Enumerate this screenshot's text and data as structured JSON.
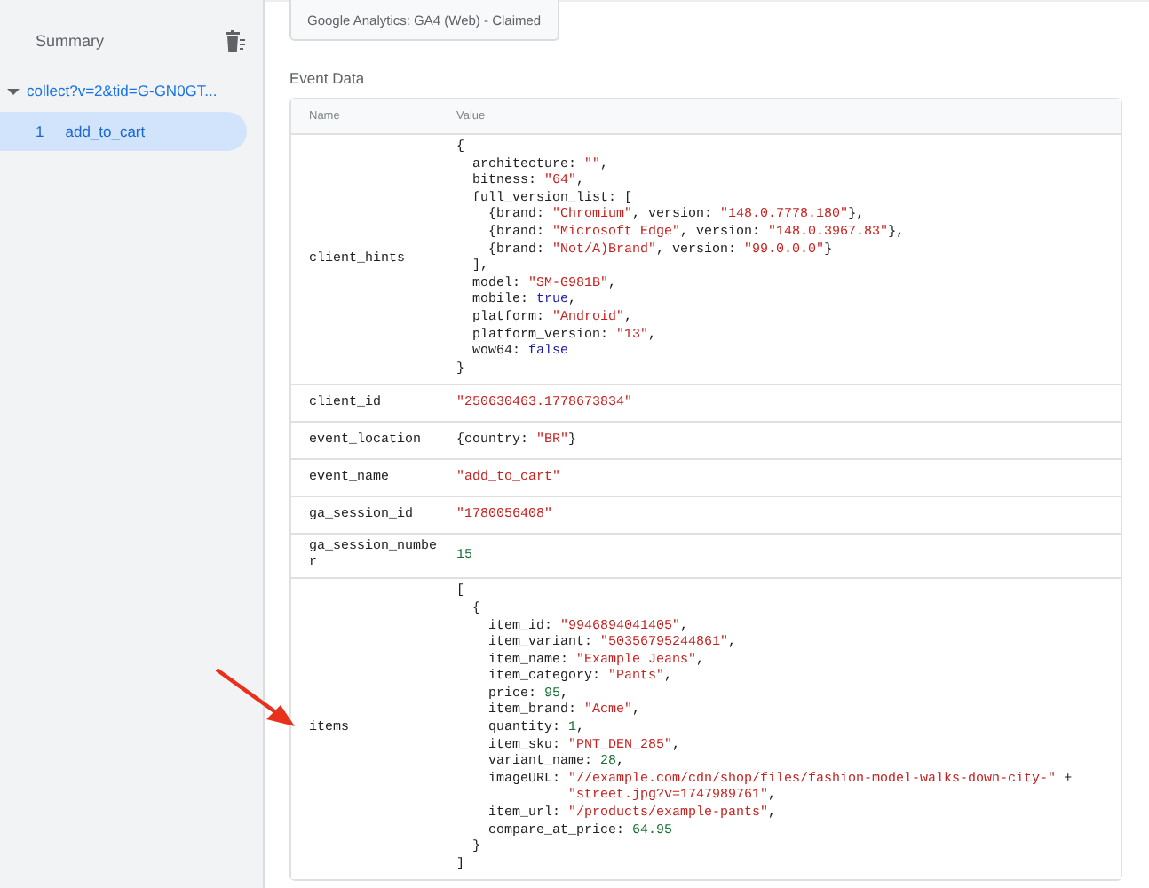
{
  "sidebar": {
    "title": "Summary",
    "request": {
      "label": "collect?v=2&tid=G-GN0GT...",
      "expanded": true
    },
    "events": [
      {
        "index": "1",
        "name": "add_to_cart",
        "selected": true
      }
    ]
  },
  "tag_card": {
    "label": "Google Analytics: GA4 (Web) - Claimed"
  },
  "section_title": "Event Data",
  "table": {
    "columns": [
      "Name",
      "Value"
    ],
    "rows": [
      {
        "name": "client_hints",
        "value": [
          [
            {
              "kind": "plain",
              "text": "{"
            }
          ],
          [
            {
              "kind": "plain",
              "text": "  architecture: "
            },
            {
              "kind": "string",
              "text": "\"\""
            },
            {
              "kind": "plain",
              "text": ","
            }
          ],
          [
            {
              "kind": "plain",
              "text": "  bitness: "
            },
            {
              "kind": "string",
              "text": "\"64\""
            },
            {
              "kind": "plain",
              "text": ","
            }
          ],
          [
            {
              "kind": "plain",
              "text": "  full_version_list: ["
            }
          ],
          [
            {
              "kind": "plain",
              "text": "    {brand: "
            },
            {
              "kind": "string",
              "text": "\"Chromium\""
            },
            {
              "kind": "plain",
              "text": ", version: "
            },
            {
              "kind": "string",
              "text": "\"148.0.7778.180\""
            },
            {
              "kind": "plain",
              "text": "},"
            }
          ],
          [
            {
              "kind": "plain",
              "text": "    {brand: "
            },
            {
              "kind": "string",
              "text": "\"Microsoft Edge\""
            },
            {
              "kind": "plain",
              "text": ", version: "
            },
            {
              "kind": "string",
              "text": "\"148.0.3967.83\""
            },
            {
              "kind": "plain",
              "text": "},"
            }
          ],
          [
            {
              "kind": "plain",
              "text": "    {brand: "
            },
            {
              "kind": "string",
              "text": "\"Not/A)Brand\""
            },
            {
              "kind": "plain",
              "text": ", version: "
            },
            {
              "kind": "string",
              "text": "\"99.0.0.0\""
            },
            {
              "kind": "plain",
              "text": "}"
            }
          ],
          [
            {
              "kind": "plain",
              "text": "  ],"
            }
          ],
          [
            {
              "kind": "plain",
              "text": "  model: "
            },
            {
              "kind": "string",
              "text": "\"SM-G981B\""
            },
            {
              "kind": "plain",
              "text": ","
            }
          ],
          [
            {
              "kind": "plain",
              "text": "  mobile: "
            },
            {
              "kind": "bool",
              "text": "true"
            },
            {
              "kind": "plain",
              "text": ","
            }
          ],
          [
            {
              "kind": "plain",
              "text": "  platform: "
            },
            {
              "kind": "string",
              "text": "\"Android\""
            },
            {
              "kind": "plain",
              "text": ","
            }
          ],
          [
            {
              "kind": "plain",
              "text": "  platform_version: "
            },
            {
              "kind": "string",
              "text": "\"13\""
            },
            {
              "kind": "plain",
              "text": ","
            }
          ],
          [
            {
              "kind": "plain",
              "text": "  wow64: "
            },
            {
              "kind": "bool",
              "text": "false"
            }
          ],
          [
            {
              "kind": "plain",
              "text": "}"
            }
          ]
        ]
      },
      {
        "name": "client_id",
        "value": [
          [
            {
              "kind": "string",
              "text": "\"250630463.1778673834\""
            }
          ]
        ]
      },
      {
        "name": "event_location",
        "value": [
          [
            {
              "kind": "plain",
              "text": "{country: "
            },
            {
              "kind": "string",
              "text": "\"BR\""
            },
            {
              "kind": "plain",
              "text": "}"
            }
          ]
        ]
      },
      {
        "name": "event_name",
        "value": [
          [
            {
              "kind": "string",
              "text": "\"add_to_cart\""
            }
          ]
        ]
      },
      {
        "name": "ga_session_id",
        "value": [
          [
            {
              "kind": "string",
              "text": "\"1780056408\""
            }
          ]
        ]
      },
      {
        "name": "ga_session_number",
        "value": [
          [
            {
              "kind": "number",
              "text": "15"
            }
          ]
        ]
      },
      {
        "name": "items",
        "value": [
          [
            {
              "kind": "plain",
              "text": "["
            }
          ],
          [
            {
              "kind": "plain",
              "text": "  {"
            }
          ],
          [
            {
              "kind": "plain",
              "text": "    item_id: "
            },
            {
              "kind": "string",
              "text": "\"9946894041405\""
            },
            {
              "kind": "plain",
              "text": ","
            }
          ],
          [
            {
              "kind": "plain",
              "text": "    item_variant: "
            },
            {
              "kind": "string",
              "text": "\"50356795244861\""
            },
            {
              "kind": "plain",
              "text": ","
            }
          ],
          [
            {
              "kind": "plain",
              "text": "    item_name: "
            },
            {
              "kind": "string",
              "text": "\"Example Jeans\""
            },
            {
              "kind": "plain",
              "text": ","
            }
          ],
          [
            {
              "kind": "plain",
              "text": "    item_category: "
            },
            {
              "kind": "string",
              "text": "\"Pants\""
            },
            {
              "kind": "plain",
              "text": ","
            }
          ],
          [
            {
              "kind": "plain",
              "text": "    price: "
            },
            {
              "kind": "number",
              "text": "95"
            },
            {
              "kind": "plain",
              "text": ","
            }
          ],
          [
            {
              "kind": "plain",
              "text": "    item_brand: "
            },
            {
              "kind": "string",
              "text": "\"Acme\""
            },
            {
              "kind": "plain",
              "text": ","
            }
          ],
          [
            {
              "kind": "plain",
              "text": "    quantity: "
            },
            {
              "kind": "number",
              "text": "1"
            },
            {
              "kind": "plain",
              "text": ","
            }
          ],
          [
            {
              "kind": "plain",
              "text": "    item_sku: "
            },
            {
              "kind": "string",
              "text": "\"PNT_DEN_285\""
            },
            {
              "kind": "plain",
              "text": ","
            }
          ],
          [
            {
              "kind": "plain",
              "text": "    variant_name: "
            },
            {
              "kind": "number",
              "text": "28"
            },
            {
              "kind": "plain",
              "text": ","
            }
          ],
          [
            {
              "kind": "plain",
              "text": "    imageURL: "
            },
            {
              "kind": "string",
              "text": "\"//example.com/cdn/shop/files/fashion-model-walks-down-city-\""
            },
            {
              "kind": "plain",
              "text": " +"
            }
          ],
          [
            {
              "kind": "string",
              "text": "              \"street.jpg?v=1747989761\""
            },
            {
              "kind": "plain",
              "text": ","
            }
          ],
          [
            {
              "kind": "plain",
              "text": "    item_url: "
            },
            {
              "kind": "string",
              "text": "\"/products/example-pants\""
            },
            {
              "kind": "plain",
              "text": ","
            }
          ],
          [
            {
              "kind": "plain",
              "text": "    compare_at_price: "
            },
            {
              "kind": "number",
              "text": "64.95"
            }
          ],
          [
            {
              "kind": "plain",
              "text": "  }"
            }
          ],
          [
            {
              "kind": "plain",
              "text": "]"
            }
          ]
        ]
      }
    ]
  }
}
